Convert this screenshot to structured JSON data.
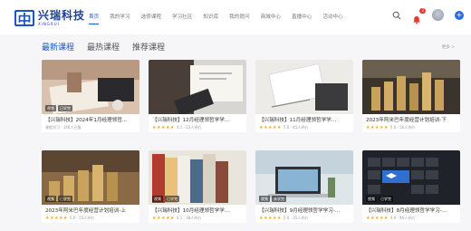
{
  "header": {
    "logo_mark": "中",
    "logo_name": "兴瑞科技",
    "logo_sub": "XINGRUI",
    "nav": [
      "首页",
      "我的学习",
      "选修课程",
      "学习社区",
      "知识库",
      "我的提问",
      "商城中心",
      "直播中心",
      "活动中心"
    ],
    "active_nav": 0,
    "notification_count": "2"
  },
  "tabs": [
    "最新课程",
    "最热课程",
    "推荐课程"
  ],
  "active_tab": 0,
  "more_label": "更多 >",
  "cards": [
    {
      "title": "【兴瑞科技】2024年1月经理领哲...",
      "meta": "课程学习 · 146人已报",
      "tags": [
        "视频",
        "已学完"
      ],
      "stars": "",
      "score": ""
    },
    {
      "title": "【兴瑞科技】12月经理领哲学学...",
      "meta": "",
      "tags": [],
      "stars": "★★★★★",
      "score": "4.1 · 23人评价"
    },
    {
      "title": "【兴瑞科技】11月经理领哲学学...",
      "meta": "",
      "tags": [],
      "stars": "★★★★★",
      "score": "5.0 · 45人评价"
    },
    {
      "title": "2023年阿米巴年度经营计划培训-下",
      "meta": "",
      "tags": [],
      "stars": "★★★★★",
      "score": "5.0 · 56人评价"
    },
    {
      "title": "2023年阿米巴年度经营计划培训-上",
      "meta": "",
      "tags": [
        "视频",
        "已学完"
      ],
      "stars": "★★★★★",
      "score": "5.0 · 55人评价"
    },
    {
      "title": "【兴瑞科技】10月经理领哲学学...",
      "meta": "",
      "tags": [
        "视频",
        "已学完"
      ],
      "stars": "★★★★★",
      "score": "4.1 · 38人评价"
    },
    {
      "title": "【兴瑞科技】9月经理领哲学学习-...",
      "meta": "",
      "tags": [
        "视频",
        "未学完"
      ],
      "stars": "★★★★★",
      "score": "5.0 · 35人评价"
    },
    {
      "title": "【兴瑞科技】8月经理领哲学学习-...",
      "meta": "",
      "tags": [
        "视频",
        "已学完"
      ],
      "stars": "★★★★★",
      "score": "4.9 · 46人评价"
    }
  ]
}
